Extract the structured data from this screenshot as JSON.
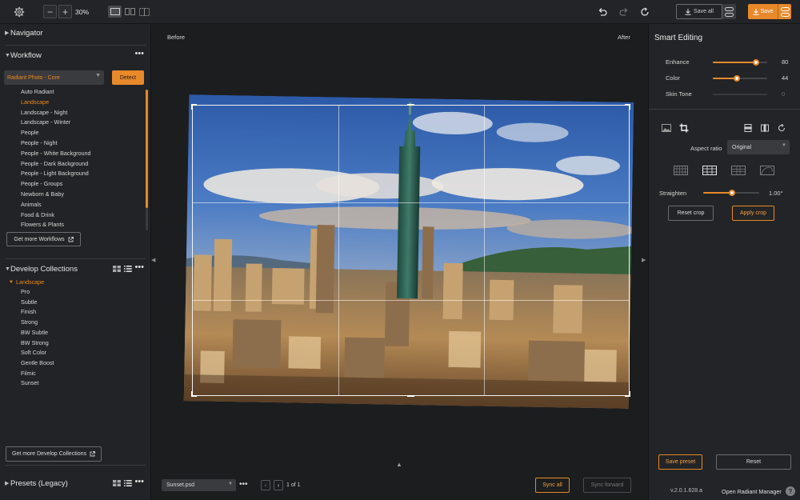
{
  "toolbar": {
    "zoom": "30%",
    "save_all": "Save all",
    "save": "Save"
  },
  "left": {
    "navigator": "Navigator",
    "workflow": "Workflow",
    "workflow_select": "Radiant Photo - Core",
    "detect": "Detect",
    "workflow_items": [
      "Auto Radiant",
      "Landscape",
      "Landscape - Night",
      "Landscape - Winter",
      "People",
      "People - Night",
      "People - White Background",
      "People - Dark Background",
      "People - Light Background",
      "People - Groups",
      "Newborn & Baby",
      "Animals",
      "Food & Drink",
      "Flowers & Plants"
    ],
    "get_more_workflows": "Get more Workflows",
    "develop_collections": "Develop Collections",
    "collection_group": "Landscape",
    "collection_items": [
      "Pro",
      "Subtle",
      "Finish",
      "Strong",
      "BW Subtle",
      "BW Strong",
      "Soft Color",
      "Gentle Boost",
      "Filmic",
      "Sunset"
    ],
    "get_more_collections": "Get more Develop Collections",
    "presets": "Presets (Legacy)"
  },
  "center": {
    "before": "Before",
    "after": "After",
    "filename": "Sunset.psd",
    "page": "1 of 1",
    "sync_all": "Sync all",
    "sync_forward": "Sync forward"
  },
  "right": {
    "title": "Smart Editing",
    "sliders": [
      {
        "label": "Enhance",
        "value": "80",
        "fraction": 0.8
      },
      {
        "label": "Color",
        "value": "44",
        "fraction": 0.44
      },
      {
        "label": "Skin Tone",
        "value": "0",
        "fraction": 0
      }
    ],
    "aspect_label": "Aspect ratio",
    "aspect_value": "Original",
    "straighten_label": "Straighten",
    "straighten_value": "1.00°",
    "straighten_fraction": 0.52,
    "reset_crop": "Reset crop",
    "apply_crop": "Apply crop",
    "save_preset": "Save preset",
    "reset": "Reset",
    "version": "v.2.0.1.628.a",
    "open_manager": "Open Radiant Manager",
    "help": "?"
  },
  "colors": {
    "accent": "#e8892a",
    "panel": "#232427"
  }
}
